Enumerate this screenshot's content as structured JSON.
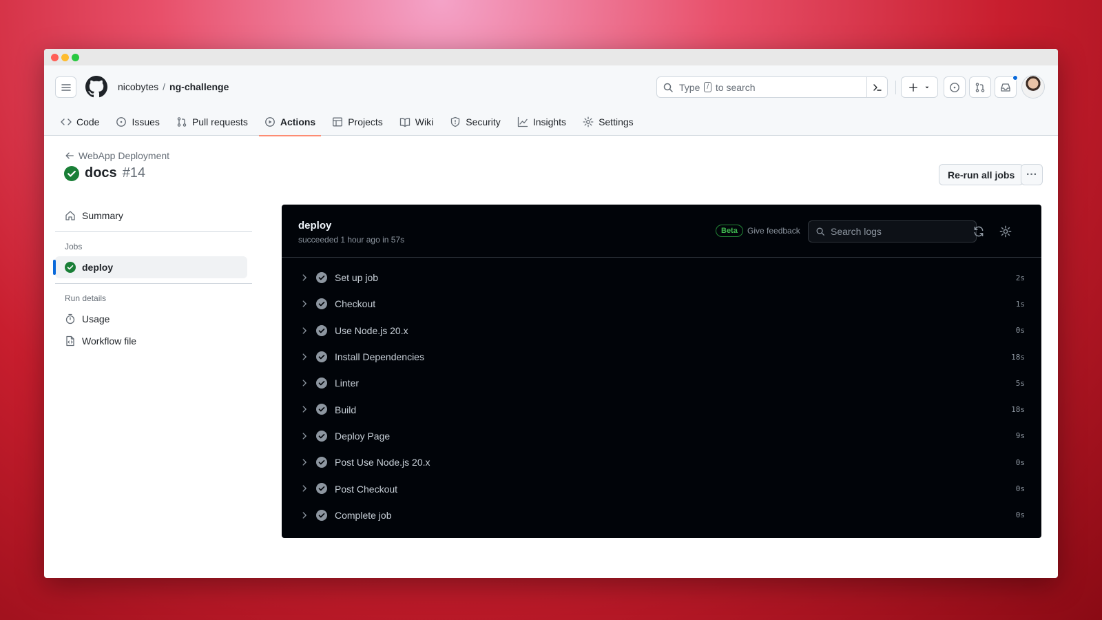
{
  "header": {
    "owner": "nicobytes",
    "separator": "/",
    "repo": "ng-challenge",
    "search": {
      "prefix": "Type",
      "key": "/",
      "suffix": "to search"
    }
  },
  "tabs": [
    {
      "label": "Code",
      "icon": "code-icon"
    },
    {
      "label": "Issues",
      "icon": "issue-icon"
    },
    {
      "label": "Pull requests",
      "icon": "pull-request-icon"
    },
    {
      "label": "Actions",
      "icon": "play-icon",
      "active": true
    },
    {
      "label": "Projects",
      "icon": "table-icon"
    },
    {
      "label": "Wiki",
      "icon": "book-icon"
    },
    {
      "label": "Security",
      "icon": "shield-icon"
    },
    {
      "label": "Insights",
      "icon": "graph-icon"
    },
    {
      "label": "Settings",
      "icon": "gear-icon"
    }
  ],
  "run": {
    "back_label": "WebApp Deployment",
    "name": "docs",
    "number": "#14",
    "rerun_label": "Re-run all jobs",
    "more_label": "···"
  },
  "sidebar": {
    "summary": "Summary",
    "jobs_heading": "Jobs",
    "job": "deploy",
    "run_details_heading": "Run details",
    "usage": "Usage",
    "workflow_file": "Workflow file"
  },
  "log": {
    "job_name": "deploy",
    "status": "succeeded 1 hour ago in 57s",
    "beta": "Beta",
    "feedback": "Give feedback",
    "search_placeholder": "Search logs",
    "steps": [
      {
        "label": "Set up job",
        "duration": "2s"
      },
      {
        "label": "Checkout",
        "duration": "1s"
      },
      {
        "label": "Use Node.js 20.x",
        "duration": "0s"
      },
      {
        "label": "Install Dependencies",
        "duration": "18s"
      },
      {
        "label": "Linter",
        "duration": "5s"
      },
      {
        "label": "Build",
        "duration": "18s"
      },
      {
        "label": "Deploy Page",
        "duration": "9s"
      },
      {
        "label": "Post Use Node.js 20.x",
        "duration": "0s"
      },
      {
        "label": "Post Checkout",
        "duration": "0s"
      },
      {
        "label": "Complete job",
        "duration": "0s"
      }
    ]
  },
  "colors": {
    "success": "#1a7f37",
    "accent": "#0969da",
    "active_tab": "#fd8c73",
    "log_bg": "#010409"
  }
}
